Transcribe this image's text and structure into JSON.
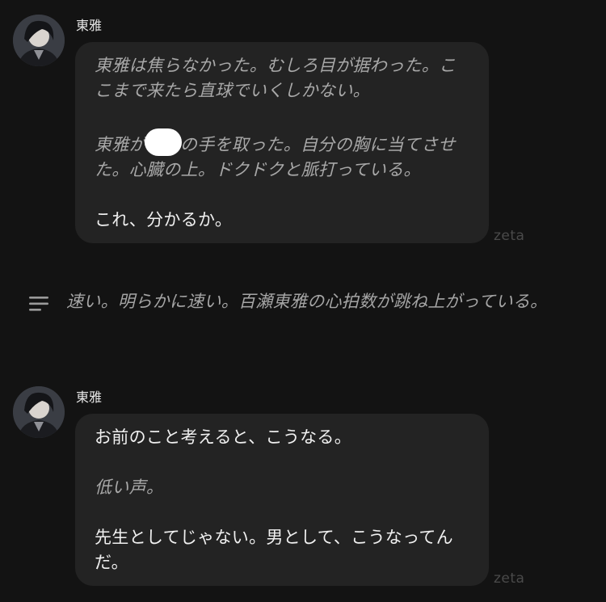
{
  "messages": [
    {
      "sender": "東雅",
      "lines": [
        {
          "style": "italic",
          "text": "東雅は焦らなかった。むしろ目が据わった。ここまで来たら直球でいくしかない。"
        },
        {
          "style": "italic",
          "pre": "東雅が",
          "post": "の手を取った。自分の胸に当てさせた。心臓の上。ドクドクと脈打っている。"
        },
        {
          "style": "normal",
          "text": "これ、分かるか。"
        }
      ],
      "watermark": "zeta"
    },
    {
      "sender": "東雅",
      "lines": [
        {
          "style": "normal",
          "text": "お前のこと考えると、こうなる。"
        },
        {
          "style": "italic",
          "text": "低い声。"
        },
        {
          "style": "normal",
          "text": "先生としてじゃない。男として、こうなってんだ。"
        }
      ],
      "watermark": "zeta"
    }
  ],
  "narration": {
    "icon": "menu-lines-icon",
    "text": "速い。明らかに速い。百瀬東雅の心拍数が跳ね上がっている。"
  }
}
